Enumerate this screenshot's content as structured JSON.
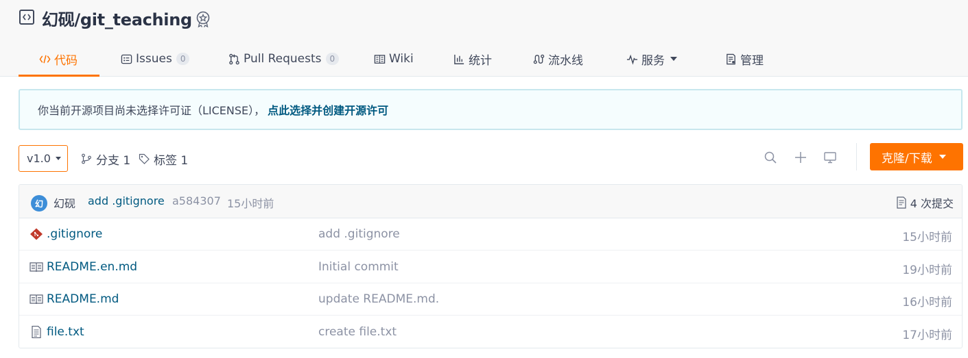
{
  "repo": {
    "title": "幻砚/git_teaching"
  },
  "tabs": [
    {
      "label": "代码",
      "icon": "code-icon",
      "active": true
    },
    {
      "label": "Issues",
      "icon": "issues-icon",
      "count": "0"
    },
    {
      "label": "Pull Requests",
      "icon": "pull-request-icon",
      "count": "0"
    },
    {
      "label": "Wiki",
      "icon": "wiki-icon"
    },
    {
      "label": "统计",
      "icon": "stats-icon"
    },
    {
      "label": "流水线",
      "icon": "pipeline-icon"
    },
    {
      "label": "服务",
      "icon": "service-icon"
    },
    {
      "label": "管理",
      "icon": "manage-icon"
    }
  ],
  "notice": {
    "message": "你当前开源项目尚未选择许可证（LICENSE），",
    "link": "点此选择并创建开源许可"
  },
  "toolbar": {
    "branch": "v1.0",
    "branches_label": "分支 1",
    "tags_label": "标签 1",
    "clone_label": "克隆/下载"
  },
  "commit": {
    "avatar_char": "幻",
    "author": "幻砚",
    "message": "add .gitignore",
    "sha": "a584307",
    "time": "15小时前",
    "count_label": "4 次提交"
  },
  "files": [
    {
      "name": ".gitignore",
      "icon": "git-file-icon",
      "commit": "add .gitignore",
      "time": "15小时前"
    },
    {
      "name": "README.en.md",
      "icon": "readme-icon",
      "commit": "Initial commit",
      "time": "19小时前"
    },
    {
      "name": "README.md",
      "icon": "readme-icon",
      "commit": "update README.md.",
      "time": "16小时前"
    },
    {
      "name": "file.txt",
      "icon": "text-file-icon",
      "commit": "create file.txt",
      "time": "17小时前"
    }
  ],
  "colors": {
    "accent": "#fe7300",
    "link": "#005980",
    "text": "#40485b",
    "muted": "#8c92a4"
  }
}
